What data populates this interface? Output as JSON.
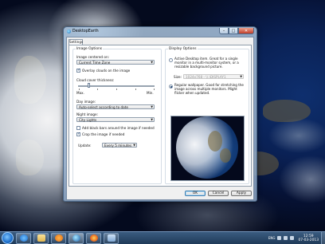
{
  "window": {
    "title": "DesktopEarth",
    "tab": "Settings",
    "close_glyph": "✕",
    "min_glyph": "–",
    "max_glyph": "□"
  },
  "image_options": {
    "group_title": "Image Options",
    "centered_label": "Image centered on:",
    "centered_value": "Current Time Zone",
    "overlay_clouds_label": "Overlay clouds on the image",
    "overlay_clouds_checked": true,
    "cloud_cover_label": "Cloud cover thickness:",
    "cloud_cover_max": "Max.",
    "cloud_cover_min": "Min.",
    "cloud_cover_level": 0.15,
    "day_image_label": "Day image:",
    "day_image_value": "Auto-select according to date",
    "night_image_label": "Night image:",
    "night_image_value": "City Lights",
    "black_bars_label": "Add black bars around the image if needed",
    "black_bars_checked": false,
    "crop_label": "Crop the image if needed",
    "crop_checked": true,
    "update_label": "Update:",
    "update_value": "Every 5 minutes"
  },
  "display_options": {
    "group_title": "Display Options",
    "active_desktop_text": "Active Desktop item. Great for a single monitor in a multi-monitor system, or a resizable background picture.",
    "active_desktop_selected": false,
    "size_label": "Size:",
    "size_value": "1024x768 - \\\\.\\DISPLAY1",
    "regular_wallpaper_text": "Regular wallpaper. Good for stretching the image across multiple monitors. Might flicker when updated.",
    "regular_wallpaper_selected": true
  },
  "buttons": {
    "ok": "OK",
    "cancel": "Cancel",
    "apply": "Apply"
  },
  "taskbar": {
    "time": "12:59",
    "date": "07-03-2013",
    "tray_lang": "ENG"
  },
  "icons": [
    "start-orb-icon",
    "ie-icon",
    "explorer-icon",
    "media-player-icon",
    "desktopearth-icon",
    "firefox-icon",
    "window-icon"
  ]
}
